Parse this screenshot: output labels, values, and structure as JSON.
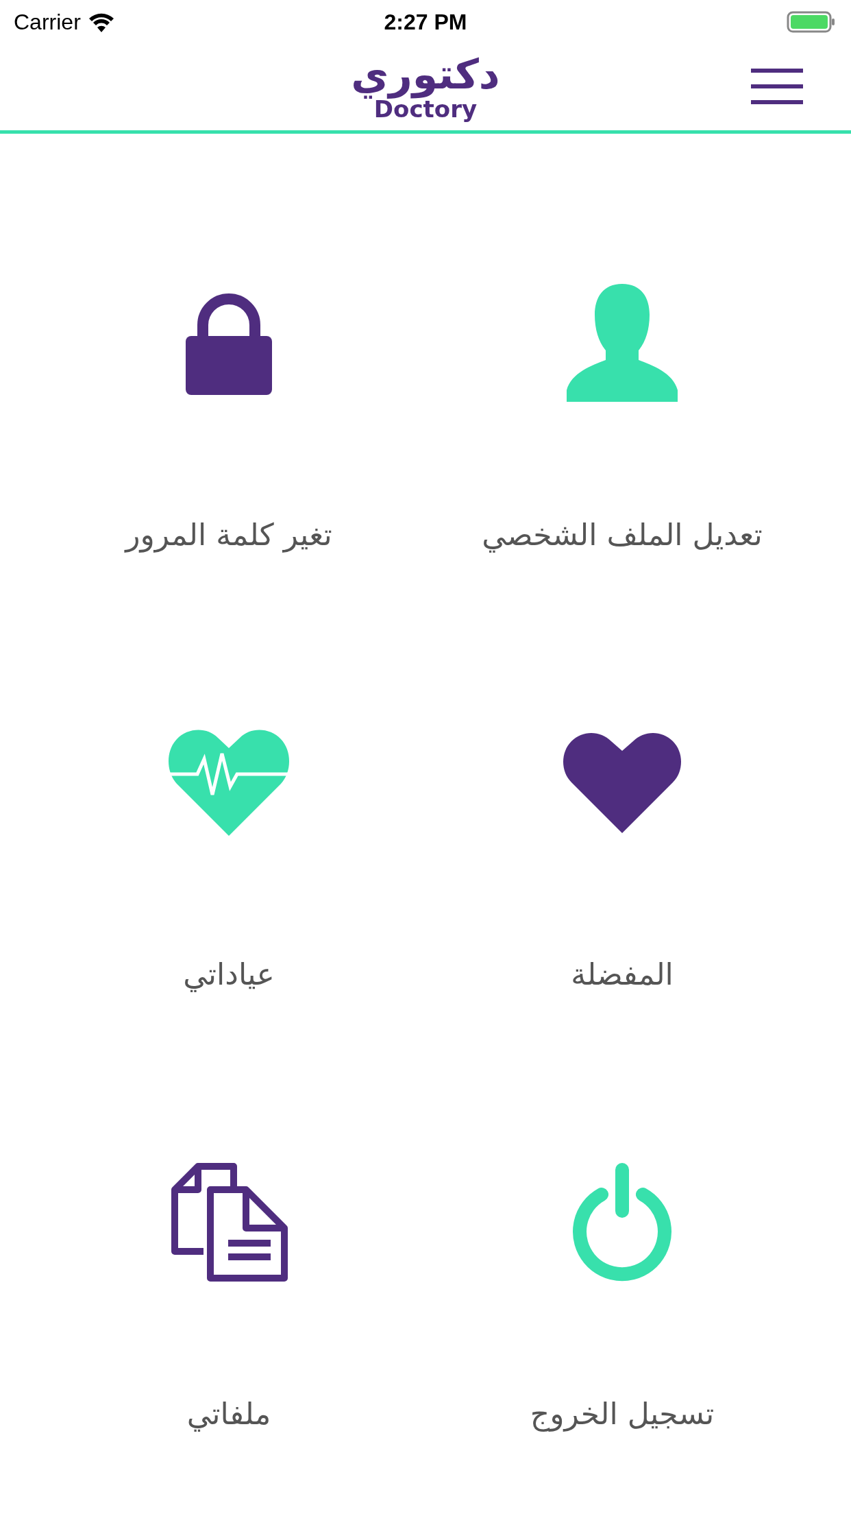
{
  "status_bar": {
    "carrier": "Carrier",
    "time": "2:27 PM"
  },
  "header": {
    "logo_arabic": "دكتوري",
    "logo_latin": "Doctory"
  },
  "menu_items": [
    {
      "kind": "profile",
      "label": "تعديل الملف الشخصي",
      "color": "#38e0ac"
    },
    {
      "kind": "password",
      "label": "تغير كلمة المرور",
      "color": "#4f2d7f"
    },
    {
      "kind": "favorites",
      "label": "المفضلة",
      "color": "#4f2d7f"
    },
    {
      "kind": "clinics",
      "label": "عياداتي",
      "color": "#38e0ac"
    },
    {
      "kind": "logout",
      "label": "تسجيل الخروج",
      "color": "#38e0ac"
    },
    {
      "kind": "files",
      "label": "ملفاتي",
      "color": "#4f2d7f"
    }
  ]
}
